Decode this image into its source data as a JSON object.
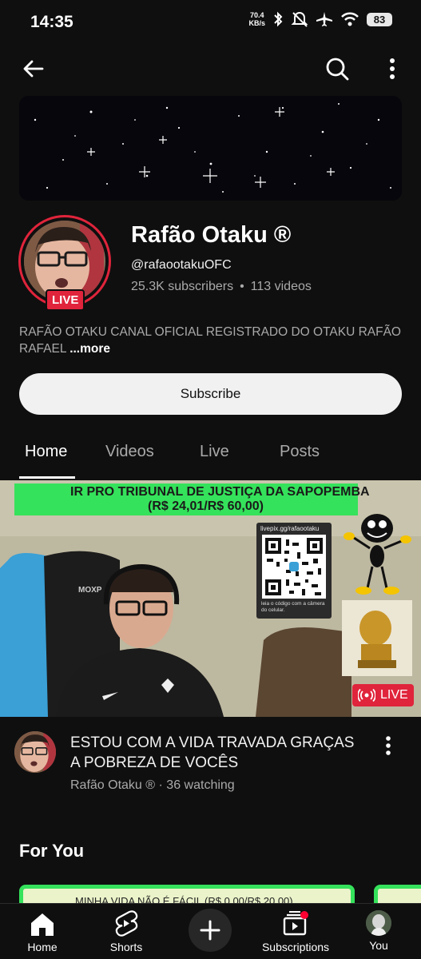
{
  "status_bar": {
    "time": "14:35",
    "speed_value": "70.4",
    "speed_unit": "KB/s",
    "battery": "83"
  },
  "channel": {
    "name": "Rafão Otaku ®",
    "handle": "@rafaootakuOFC",
    "subscribers": "25.3K subscribers",
    "videos": "113 videos",
    "live_badge": "LIVE",
    "description": "RAFÃO OTAKU CANAL OFICIAL REGISTRADO DO OTAKU RAFÃO RAFAEL",
    "more_label": "...more"
  },
  "subscribe_label": "Subscribe",
  "tabs": [
    {
      "label": "Home",
      "active": true
    },
    {
      "label": "Videos",
      "active": false
    },
    {
      "label": "Live",
      "active": false
    },
    {
      "label": "Posts",
      "active": false
    }
  ],
  "live_video": {
    "overlay_line1": "IR PRO TRIBUNAL DE JUSTIÇA DA SAPOPEMBA",
    "overlay_line2": "(R$ 24,01/R$ 60,00)",
    "qr_url": "livepix.gg/rafaootaku",
    "qr_caption": "leia o código com a câmera do celular.",
    "live_label": "LIVE",
    "title": "ESTOU COM A VIDA TRAVADA GRAÇAS A POBREZA DE VOCÊS",
    "channel_name": "Rafão Otaku ®",
    "watching": "36 watching"
  },
  "for_you": {
    "title": "For You",
    "card_text": "MINHA VIDA NÃO É FÁCIL (R$ 0,00/R$ 20,00)"
  },
  "bottom_nav": {
    "home": "Home",
    "shorts": "Shorts",
    "subscriptions": "Subscriptions",
    "you": "You"
  },
  "colors": {
    "background": "#0f0f0f",
    "live_red": "#e0243b",
    "overlay_green": "#35e25b"
  },
  "icons": [
    "back-arrow-icon",
    "search-icon",
    "more-vert-icon",
    "home-icon",
    "shorts-icon",
    "create-icon",
    "subscriptions-icon",
    "bluetooth-icon",
    "wifi-icon",
    "airplane-icon"
  ]
}
